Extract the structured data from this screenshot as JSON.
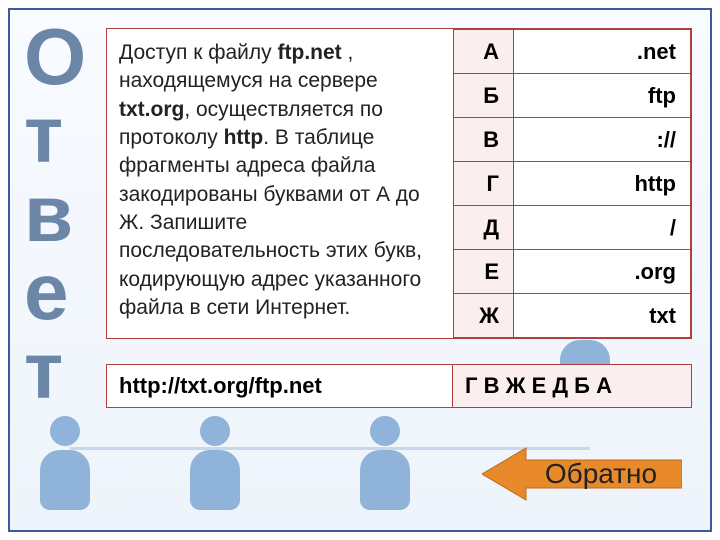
{
  "title_vertical": "Ответ",
  "question": {
    "pre1": "Доступ к файлу ",
    "b1": "ftp.net",
    "mid1": " , находящемуся на сервере ",
    "b2": "txt.org",
    "mid2": ", осуществляется по протоколу ",
    "b3": "http",
    "post": ". В таблице фрагменты адреса файла закодированы буквами от А до Ж. Запишите последовательность этих букв, кодирующую адрес указанного файла в сети Интернет."
  },
  "fragments": [
    {
      "letter": "А",
      "frag": ".net"
    },
    {
      "letter": "Б",
      "frag": "ftp"
    },
    {
      "letter": "В",
      "frag": "://"
    },
    {
      "letter": "Г",
      "frag": "http"
    },
    {
      "letter": "Д",
      "frag": "/"
    },
    {
      "letter": "Е",
      "frag": ".org"
    },
    {
      "letter": "Ж",
      "frag": "txt"
    }
  ],
  "answer": {
    "url": "http://txt.org/ftp.net",
    "sequence": "Г В Ж Е Д Б А"
  },
  "back_label": "Обратно"
}
